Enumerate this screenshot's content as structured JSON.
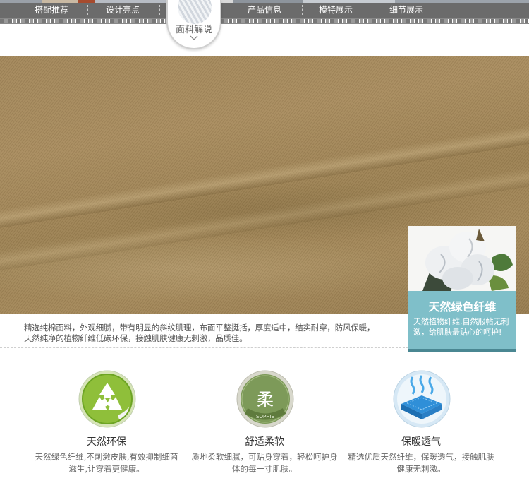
{
  "nav": {
    "items": [
      "搭配推荐",
      "设计亮点",
      "产品信息",
      "模特展示",
      "细节展示"
    ],
    "badge_label": "面料解说"
  },
  "fabric": {
    "image": "khaki-cotton-twill-fabric-photo",
    "color": "#a3875a"
  },
  "card": {
    "image": "cotton-boll-photo",
    "title": "天然绿色纤维",
    "text": "天然植物纤维,自然服帖无刺激，给肌肤最贴心的呵护!",
    "color": "#7fbfc9"
  },
  "description": "精选纯棉面料，外观细腻，带有明显的斜纹肌理，布面平整挺括，厚度适中，结实耐穿，防风保暖，天然纯净的植物纤维低碳环保，接触肌肤健康无刺激，品质佳。",
  "features": [
    {
      "icon": "recycle-icon",
      "title": "天然环保",
      "text": "天然绿色纤维,不刺激皮肤,有效抑制细菌滋生,让穿着更健康。"
    },
    {
      "icon": "soft-badge-icon",
      "icon_glyph": "柔",
      "icon_caption": "SOPHIE",
      "title": "舒适柔软",
      "text": "质地柔软细腻，可贴身穿着，轻松呵护身体的每一寸肌肤。"
    },
    {
      "icon": "breathable-fabric-icon",
      "title": "保暖透气",
      "text": "精选优质天然纤维，保暖透气，接触肌肤健康无刺激。"
    }
  ]
}
